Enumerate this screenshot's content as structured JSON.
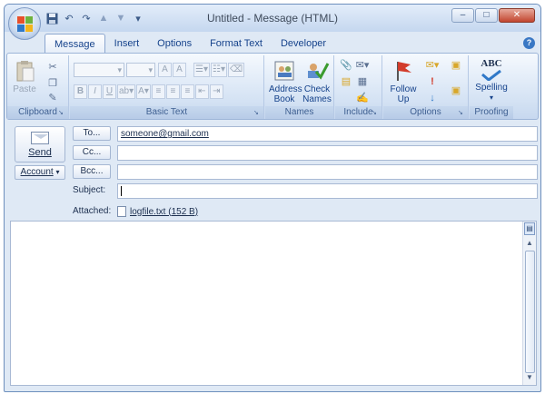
{
  "window": {
    "title": "Untitled - Message (HTML)",
    "controls": {
      "minimize": "–",
      "maximize": "□",
      "close": "✕"
    }
  },
  "tabs": [
    "Message",
    "Insert",
    "Options",
    "Format Text",
    "Developer"
  ],
  "ribbon": {
    "clipboard": {
      "paste": "Paste",
      "label": "Clipboard"
    },
    "basic_text": {
      "bold": "B",
      "italic": "I",
      "underline": "U",
      "font_grow": "A",
      "font_shrink": "A",
      "label": "Basic Text"
    },
    "names": {
      "address_book_1": "Address",
      "address_book_2": "Book",
      "check_names_1": "Check",
      "check_names_2": "Names",
      "label": "Names"
    },
    "include": {
      "label": "Include"
    },
    "options": {
      "follow_up_1": "Follow",
      "follow_up_2": "Up",
      "label": "Options"
    },
    "proofing": {
      "spelling": "Spelling",
      "abc": "ABC",
      "label": "Proofing"
    }
  },
  "compose": {
    "send_label": "Send",
    "account_label": "Account",
    "to_button": "To...",
    "cc_button": "Cc...",
    "bcc_button": "Bcc...",
    "to_value": "someone@gmail.com",
    "cc_value": "",
    "bcc_value": "",
    "subject_label": "Subject:",
    "subject_value": "",
    "attached_label": "Attached:",
    "attachment": "logfile.txt (152 B)"
  },
  "colors": {
    "accent": "#15428b",
    "ribbon_bg": "#dfe9f5",
    "flag_red": "#d23b2b"
  }
}
